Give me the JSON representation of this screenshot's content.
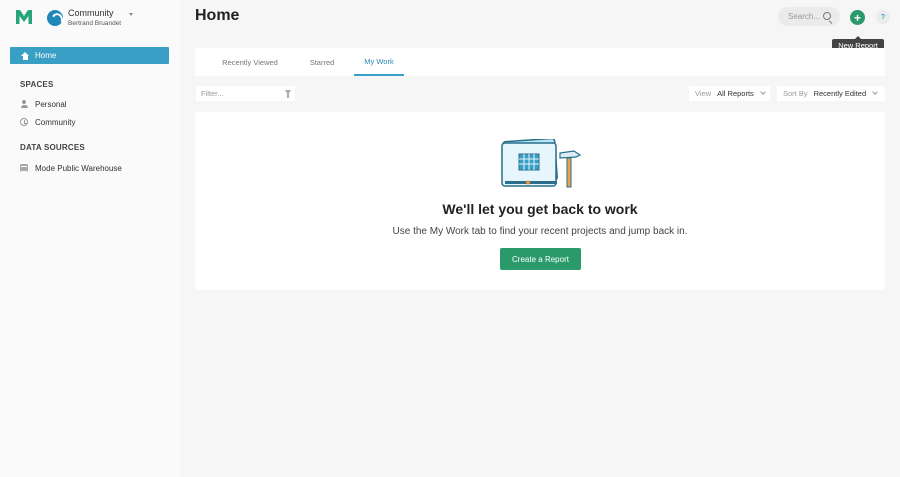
{
  "org": {
    "name": "Community",
    "user": "Bertrand Bruandet"
  },
  "sidebar": {
    "home_label": "Home",
    "spaces_title": "SPACES",
    "spaces": [
      {
        "label": "Personal",
        "icon": "person-icon"
      },
      {
        "label": "Community",
        "icon": "clock-icon"
      }
    ],
    "data_sources_title": "DATA SOURCES",
    "data_sources": [
      {
        "label": "Mode Public Warehouse",
        "icon": "database-icon"
      }
    ]
  },
  "header": {
    "title": "Home",
    "search_placeholder": "Search...",
    "new_button_symbol": "+",
    "help_symbol": "?",
    "tooltip": "New Report"
  },
  "tabs": [
    {
      "label": "Recently Viewed",
      "active": false
    },
    {
      "label": "Starred",
      "active": false
    },
    {
      "label": "My Work",
      "active": true
    }
  ],
  "filter": {
    "placeholder": "Filter..."
  },
  "view_select": {
    "label": "View",
    "value": "All Reports"
  },
  "sort_select": {
    "label": "Sort By",
    "value": "Recently Edited"
  },
  "empty_state": {
    "title": "We'll let you get back to work",
    "subtitle": "Use the My Work tab to find your recent projects and jump back in.",
    "button_label": "Create a Report"
  },
  "colors": {
    "accent": "#3a9fc4",
    "primary_button": "#2b9a6a",
    "logo": "#2aa57a"
  }
}
